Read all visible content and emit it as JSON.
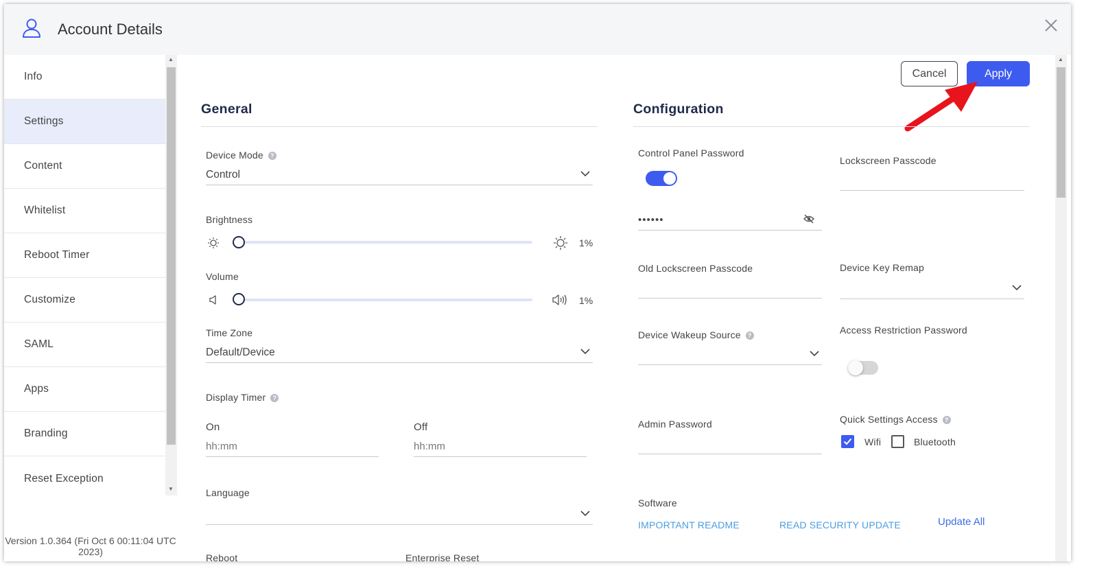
{
  "window": {
    "title": "Account Details"
  },
  "sidebar": {
    "items": [
      {
        "label": "Info"
      },
      {
        "label": "Settings",
        "active": true
      },
      {
        "label": "Content"
      },
      {
        "label": "Whitelist"
      },
      {
        "label": "Reboot Timer"
      },
      {
        "label": "Customize"
      },
      {
        "label": "SAML"
      },
      {
        "label": "Apps"
      },
      {
        "label": "Branding"
      },
      {
        "label": "Reset Exception"
      }
    ],
    "version_line1": "Version 1.0.364 (Fri Oct 6 00:11:04 UTC",
    "version_line2": "2023)"
  },
  "actions": {
    "cancel_label": "Cancel",
    "apply_label": "Apply"
  },
  "general": {
    "title": "General",
    "device_mode": {
      "label": "Device Mode",
      "value": "Control"
    },
    "brightness": {
      "label": "Brightness",
      "value": "1%"
    },
    "volume": {
      "label": "Volume",
      "value": "1%"
    },
    "time_zone": {
      "label": "Time Zone",
      "value": "Default/Device"
    },
    "display_timer": {
      "label": "Display Timer",
      "on_label": "On",
      "on_placeholder": "hh:mm",
      "off_label": "Off",
      "off_placeholder": "hh:mm"
    },
    "language": {
      "label": "Language",
      "value": ""
    },
    "reboot_label": "Reboot",
    "enterprise_reset_label": "Enterprise Reset"
  },
  "configuration": {
    "title": "Configuration",
    "control_panel_password": {
      "label": "Control Panel Password",
      "enabled": true,
      "value": "••••••"
    },
    "lockscreen_passcode": {
      "label": "Lockscreen Passcode"
    },
    "old_lockscreen_passcode": {
      "label": "Old Lockscreen Passcode"
    },
    "device_key_remap": {
      "label": "Device Key Remap"
    },
    "device_wakeup_source": {
      "label": "Device Wakeup Source"
    },
    "access_restriction_password": {
      "label": "Access Restriction Password",
      "enabled": false
    },
    "admin_password": {
      "label": "Admin Password"
    },
    "quick_settings_access": {
      "label": "Quick Settings Access",
      "wifi_label": "Wifi",
      "wifi_checked": true,
      "bluetooth_label": "Bluetooth",
      "bluetooth_checked": false
    },
    "software": {
      "label": "Software",
      "important_readme": "IMPORTANT README",
      "read_security_update": "READ SECURITY UPDATE",
      "update_all": "Update All"
    }
  },
  "colors": {
    "accent": "#3e5bf0",
    "annotation_arrow": "#e8141c",
    "link": "#4a9de0"
  }
}
